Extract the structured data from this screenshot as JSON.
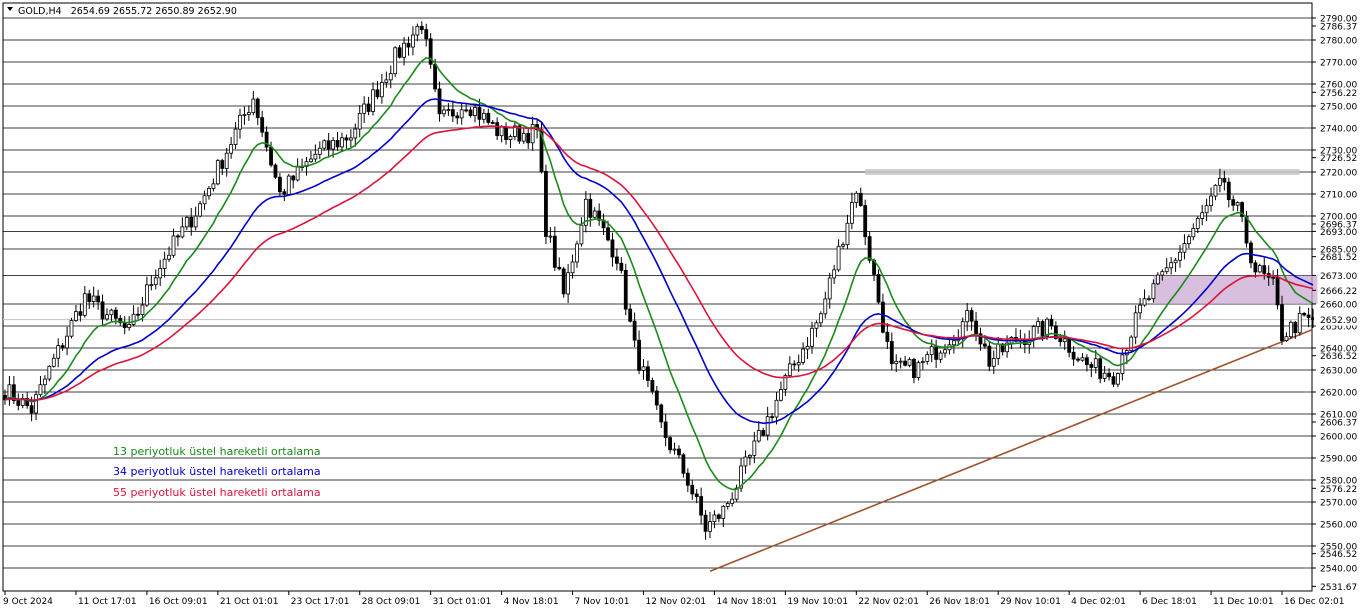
{
  "chart_data": {
    "type": "candlestick",
    "symbol": "GOLD,H4",
    "ohlc_text": "2654.69 2655.72 2650.89 2652.90",
    "current_price_label": "2652.90",
    "ylim": [
      2531.67,
      2791.5
    ],
    "y_ticks": [
      {
        "v": 2790.0,
        "t": "2790.00",
        "h": true
      },
      {
        "v": 2786.37,
        "t": "2786.37",
        "h": false
      },
      {
        "v": 2780.0,
        "t": "2780.00",
        "h": true
      },
      {
        "v": 2770.0,
        "t": "2770.00",
        "h": true
      },
      {
        "v": 2760.0,
        "t": "2760.00",
        "h": true
      },
      {
        "v": 2756.22,
        "t": "2756.22",
        "h": false
      },
      {
        "v": 2750.0,
        "t": "2750.00",
        "h": true
      },
      {
        "v": 2740.0,
        "t": "2740.00",
        "h": true
      },
      {
        "v": 2730.0,
        "t": "2730.00",
        "h": true
      },
      {
        "v": 2726.52,
        "t": "2726.52",
        "h": false
      },
      {
        "v": 2720.0,
        "t": "2720.00",
        "h": true
      },
      {
        "v": 2710.0,
        "t": "2710.00",
        "h": true
      },
      {
        "v": 2700.0,
        "t": "2700.00",
        "h": true
      },
      {
        "v": 2696.37,
        "t": "2696.37",
        "h": false
      },
      {
        "v": 2693.0,
        "t": "2693.00",
        "h": true
      },
      {
        "v": 2685.0,
        "t": "2685.00",
        "h": true
      },
      {
        "v": 2681.52,
        "t": "2681.52",
        "h": false
      },
      {
        "v": 2673.0,
        "t": "2673.00",
        "h": true
      },
      {
        "v": 2666.22,
        "t": "2666.22",
        "h": false
      },
      {
        "v": 2660.0,
        "t": "2660.00",
        "h": true
      },
      {
        "v": 2650.0,
        "t": "2650.00",
        "h": true
      },
      {
        "v": 2640.0,
        "t": "2640.00",
        "h": true
      },
      {
        "v": 2636.52,
        "t": "2636.52",
        "h": false
      },
      {
        "v": 2630.0,
        "t": "2630.00",
        "h": true
      },
      {
        "v": 2620.0,
        "t": "2620.00",
        "h": true
      },
      {
        "v": 2610.0,
        "t": "2610.00",
        "h": true
      },
      {
        "v": 2606.37,
        "t": "2606.37",
        "h": false
      },
      {
        "v": 2600.0,
        "t": "2600.00",
        "h": true
      },
      {
        "v": 2590.0,
        "t": "2590.00",
        "h": true
      },
      {
        "v": 2580.0,
        "t": "2580.00",
        "h": true
      },
      {
        "v": 2576.22,
        "t": "2576.22",
        "h": false
      },
      {
        "v": 2570.0,
        "t": "2570.00",
        "h": true
      },
      {
        "v": 2560.0,
        "t": "2560.00",
        "h": true
      },
      {
        "v": 2550.0,
        "t": "2550.00",
        "h": true
      },
      {
        "v": 2546.52,
        "t": "2546.52",
        "h": false
      },
      {
        "v": 2540.0,
        "t": "2540.00",
        "h": true
      },
      {
        "v": 2531.67,
        "t": "2531.67",
        "h": false
      }
    ],
    "x_labels": [
      "9 Oct 2024",
      "11 Oct 17:01",
      "16 Oct 09:01",
      "21 Oct 01:01",
      "23 Oct 17:01",
      "28 Oct 09:01",
      "31 Oct 01:01",
      "4 Nov 18:01",
      "7 Nov 10:01",
      "12 Nov 02:01",
      "14 Nov 18:01",
      "19 Nov 10:01",
      "22 Nov 02:01",
      "26 Nov 18:01",
      "29 Nov 10:01",
      "4 Dec 02:01",
      "6 Dec 18:01",
      "11 Dec 10:01",
      "16 Dec 02:01"
    ],
    "x_label_bars": [
      0,
      16,
      32,
      48,
      64,
      80,
      96,
      112,
      128,
      144,
      160,
      176,
      192,
      208,
      224,
      240,
      256,
      272,
      288
    ],
    "bar_count": 296,
    "anchors": [
      [
        0,
        2621
      ],
      [
        6,
        2612
      ],
      [
        10,
        2630
      ],
      [
        18,
        2663
      ],
      [
        28,
        2647
      ],
      [
        34,
        2675
      ],
      [
        44,
        2705
      ],
      [
        52,
        2738
      ],
      [
        56,
        2754
      ],
      [
        62,
        2710
      ],
      [
        70,
        2728
      ],
      [
        78,
        2737
      ],
      [
        88,
        2772
      ],
      [
        94,
        2788
      ],
      [
        98,
        2743
      ],
      [
        104,
        2752
      ],
      [
        112,
        2737
      ],
      [
        120,
        2738
      ],
      [
        122,
        2695
      ],
      [
        126,
        2664
      ],
      [
        131,
        2707
      ],
      [
        138,
        2682
      ],
      [
        142,
        2640
      ],
      [
        148,
        2604
      ],
      [
        154,
        2580
      ],
      [
        158,
        2558
      ],
      [
        162,
        2566
      ],
      [
        168,
        2590
      ],
      [
        176,
        2625
      ],
      [
        184,
        2655
      ],
      [
        192,
        2713
      ],
      [
        196,
        2672
      ],
      [
        200,
        2630
      ],
      [
        206,
        2631
      ],
      [
        212,
        2643
      ],
      [
        218,
        2655
      ],
      [
        222,
        2634
      ],
      [
        228,
        2644
      ],
      [
        236,
        2650
      ],
      [
        244,
        2632
      ],
      [
        250,
        2628
      ],
      [
        256,
        2657
      ],
      [
        262,
        2675
      ],
      [
        270,
        2700
      ],
      [
        274,
        2714
      ],
      [
        278,
        2702
      ],
      [
        282,
        2676
      ],
      [
        286,
        2668
      ],
      [
        288,
        2646
      ],
      [
        292,
        2652
      ],
      [
        295,
        2652.9
      ]
    ],
    "series": [
      {
        "name": "13 periyotluk üstel hareketli ortalama",
        "period": 13,
        "color": "#1a8a1a"
      },
      {
        "name": "34 periyotluk üstel hareketli ortalama",
        "period": 34,
        "color": "#0000cc"
      },
      {
        "name": "55 periyotluk üstel hareketli ortalama",
        "period": 55,
        "color": "#dc143c"
      }
    ],
    "trendline": {
      "start": [
        159,
        2538.5
      ],
      "end": [
        295,
        2648.5
      ],
      "extend_to": 2673.5,
      "color": "#a0522d"
    },
    "resistance_line": {
      "x_from": 194,
      "x_to": 292,
      "price": 2720
    },
    "zone": {
      "x_from": 259,
      "x_to": 296,
      "top": 2673,
      "bottom": 2660,
      "color": "#c9a9d2"
    },
    "colors": {
      "candle": "#000000",
      "grid": "#000000",
      "current_price": "#c0c0c0"
    }
  }
}
